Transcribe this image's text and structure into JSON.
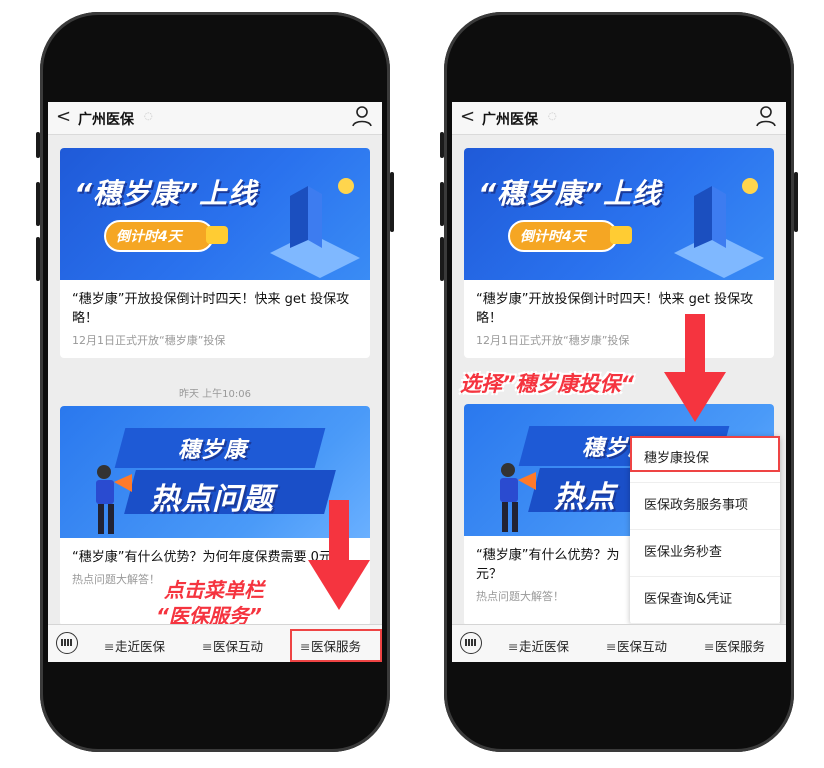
{
  "phones": {
    "left": {
      "header": {
        "back": "<",
        "title": "广州医保"
      },
      "article1": {
        "banner_line": "“穗岁康”上线",
        "banner_pill": "倒计时4天",
        "title": "“穗岁康”开放投保倒计时四天！快来 get 投保攻略！",
        "subtitle": "12月1日正式开放“穗岁康”投保"
      },
      "timestamp": "昨天 上午10:06",
      "article2": {
        "banner_line1": "穗岁康",
        "banner_line2": "热点问题",
        "title": "“穗岁康”有什么优势？为何年度保费需要 0元？",
        "subtitle": "热点问题大解答！"
      },
      "annotation": {
        "line1": "点击菜单栏",
        "line2": "“医保服务”"
      },
      "menu": [
        "走近医保",
        "医保互动",
        "医保服务"
      ]
    },
    "right": {
      "header": {
        "back": "<",
        "title": "广州医保"
      },
      "article1": {
        "banner_line": "“穗岁康”上线",
        "banner_pill": "倒计时4天",
        "title": "“穗岁康”开放投保倒计时四天！快来 get 投保攻略！",
        "subtitle": "12月1日正式开放“穗岁康”投保"
      },
      "annotation": "选择”穗岁康投保“",
      "article2": {
        "banner_line1": "穗岁康",
        "banner_line2": "热点",
        "title": "“穗岁康”有什么优势？为",
        "title2": "元？",
        "subtitle": "热点问题大解答！"
      },
      "popup": [
        "穗岁康投保",
        "医保政务服务事项",
        "医保业务秒查",
        "医保查询&凭证"
      ],
      "menu": [
        "走近医保",
        "医保互动",
        "医保服务"
      ]
    }
  },
  "colors": {
    "accent_red": "#f5343f",
    "banner_blue": "#2a72ee",
    "pill_orange": "#f5a623"
  }
}
